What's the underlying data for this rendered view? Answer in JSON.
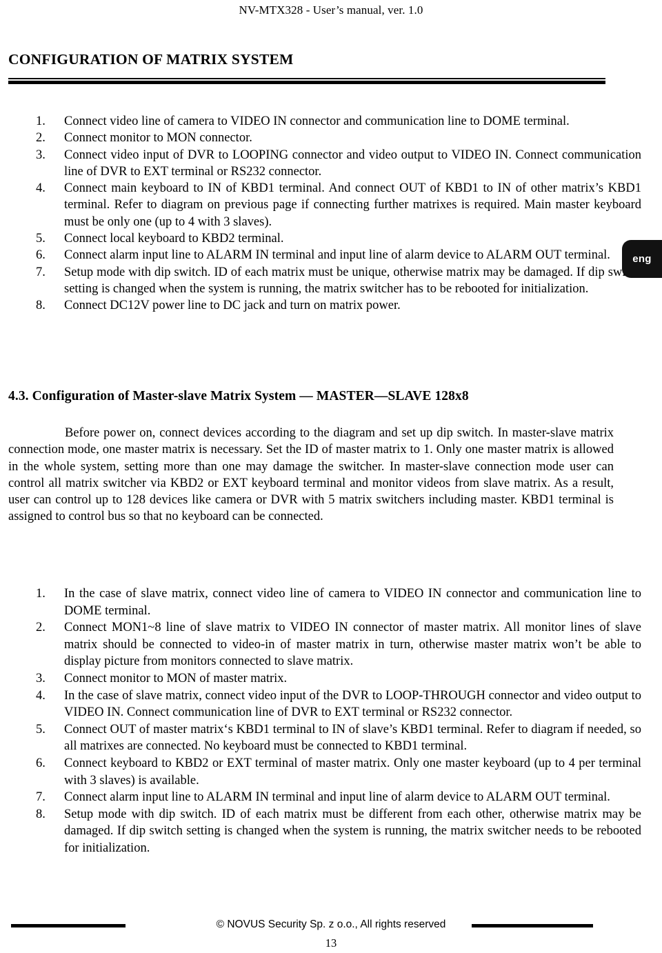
{
  "header": {
    "running_title": "NV-MTX328  - User’s manual, ver. 1.0"
  },
  "title": {
    "text": "CONFIGURATION OF MATRIX SYSTEM"
  },
  "side_tab": {
    "label": "eng",
    "background_color": "#121212",
    "text_color": "#ffffff"
  },
  "instructions_list": {
    "items": [
      {
        "marker": "1.",
        "text": "Connect video line of camera to VIDEO IN connector and communication line to DOME terminal."
      },
      {
        "marker": "2.",
        "text": "Connect monitor to MON connector."
      },
      {
        "marker": "3.",
        "text": "Connect video input of DVR to LOOPING connector and video output to VIDEO IN. Connect communication line of DVR to EXT terminal or RS232 connector."
      },
      {
        "marker": "4.",
        "text": "Connect main keyboard to IN of KBD1 terminal. And connect OUT of KBD1 to IN of other matrix’s KBD1 terminal. Refer to diagram on previous page if connecting further matrixes is required. Main master keyboard must be only one (up to 4 with 3 slaves)."
      },
      {
        "marker": "5.",
        "text": "Connect local keyboard to KBD2 terminal."
      },
      {
        "marker": "6.",
        "text": "Connect alarm input line to ALARM IN terminal and input line of alarm device to ALARM OUT terminal."
      },
      {
        "marker": "7.",
        "text": "Setup mode with dip switch. ID of each matrix must be unique, otherwise matrix may be damaged. If dip switch setting is changed when the system is running, the matrix switcher has to be rebooted for initialization."
      },
      {
        "marker": "8.",
        "text": "Connect DC12V power line to DC jack and turn on matrix power."
      }
    ]
  },
  "section": {
    "heading": "4.3. Configuration of Master-slave Matrix System  — MASTER—SLAVE  128x8",
    "paragraph": "Before power on, connect devices according to the diagram and set up dip switch. In master-slave matrix connection mode, one master matrix is necessary. Set the ID of master matrix to 1. Only one master matrix is allowed in the whole system, setting more than one may damage the switcher. In master-slave connection mode user can control all matrix switcher via KBD2 or EXT keyboard terminal and monitor videos from slave matrix. As a result, user can control up to 128 devices like camera or DVR with 5 matrix switchers including master. KBD1 terminal is assigned to control bus so that no keyboard can be connected."
  },
  "master_slave_list": {
    "items": [
      {
        "marker": "1.",
        "text": "In the case of slave matrix, connect video line of camera to VIDEO IN connector and communication line to DOME terminal."
      },
      {
        "marker": "2.",
        "text": "Connect MON1~8 line of slave matrix to VIDEO IN connector of master matrix. All monitor lines of slave matrix should be connected to video-in of master matrix in turn, otherwise master matrix won’t be able to display picture from monitors connected to slave matrix."
      },
      {
        "marker": "3.",
        "text": "Connect monitor to MON of master matrix."
      },
      {
        "marker": "4.",
        "text": "In the case of slave matrix, connect video input of the DVR to LOOP-THROUGH connector and video output to VIDEO IN. Connect communication line of DVR to EXT terminal or RS232 connector."
      },
      {
        "marker": "5.",
        "text": "Connect OUT of master matrix‘s KBD1 terminal to IN of slave’s KBD1 terminal. Refer to diagram if needed, so all matrixes are connected. No keyboard must be connected to KBD1 terminal."
      },
      {
        "marker": "6.",
        "text": "Connect keyboard to KBD2 or EXT terminal of master matrix. Only one master keyboard (up to 4 per terminal with 3 slaves) is available."
      },
      {
        "marker": "7.",
        "text": "Connect alarm input line to ALARM IN terminal and input line of alarm device to ALARM OUT terminal."
      },
      {
        "marker": "8.",
        "text": "Setup mode with dip switch. ID of each matrix must be different from each other, otherwise matrix may be damaged. If dip switch setting is changed when the system is running, the matrix switcher needs to be rebooted for initialization."
      }
    ]
  },
  "footer": {
    "copyright": "© NOVUS Security Sp. z o.o., All rights reserved",
    "page_number": "13"
  }
}
